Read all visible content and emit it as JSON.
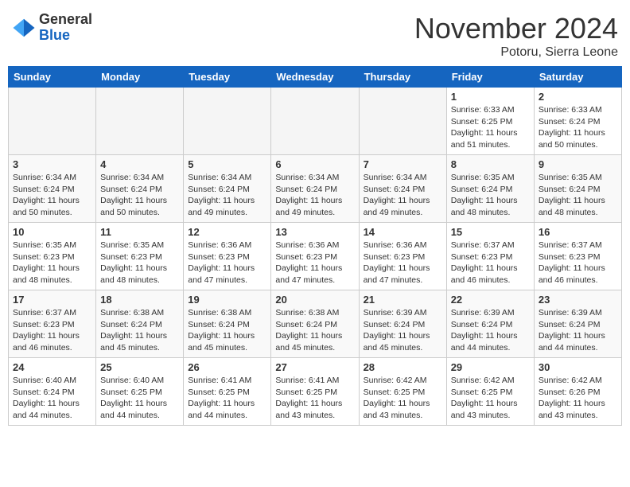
{
  "header": {
    "logo_general": "General",
    "logo_blue": "Blue",
    "month_title": "November 2024",
    "location": "Potoru, Sierra Leone"
  },
  "days_of_week": [
    "Sunday",
    "Monday",
    "Tuesday",
    "Wednesday",
    "Thursday",
    "Friday",
    "Saturday"
  ],
  "weeks": [
    [
      {
        "num": "",
        "info": ""
      },
      {
        "num": "",
        "info": ""
      },
      {
        "num": "",
        "info": ""
      },
      {
        "num": "",
        "info": ""
      },
      {
        "num": "",
        "info": ""
      },
      {
        "num": "1",
        "info": "Sunrise: 6:33 AM\nSunset: 6:25 PM\nDaylight: 11 hours and 51 minutes."
      },
      {
        "num": "2",
        "info": "Sunrise: 6:33 AM\nSunset: 6:24 PM\nDaylight: 11 hours and 50 minutes."
      }
    ],
    [
      {
        "num": "3",
        "info": "Sunrise: 6:34 AM\nSunset: 6:24 PM\nDaylight: 11 hours and 50 minutes."
      },
      {
        "num": "4",
        "info": "Sunrise: 6:34 AM\nSunset: 6:24 PM\nDaylight: 11 hours and 50 minutes."
      },
      {
        "num": "5",
        "info": "Sunrise: 6:34 AM\nSunset: 6:24 PM\nDaylight: 11 hours and 49 minutes."
      },
      {
        "num": "6",
        "info": "Sunrise: 6:34 AM\nSunset: 6:24 PM\nDaylight: 11 hours and 49 minutes."
      },
      {
        "num": "7",
        "info": "Sunrise: 6:34 AM\nSunset: 6:24 PM\nDaylight: 11 hours and 49 minutes."
      },
      {
        "num": "8",
        "info": "Sunrise: 6:35 AM\nSunset: 6:24 PM\nDaylight: 11 hours and 48 minutes."
      },
      {
        "num": "9",
        "info": "Sunrise: 6:35 AM\nSunset: 6:24 PM\nDaylight: 11 hours and 48 minutes."
      }
    ],
    [
      {
        "num": "10",
        "info": "Sunrise: 6:35 AM\nSunset: 6:23 PM\nDaylight: 11 hours and 48 minutes."
      },
      {
        "num": "11",
        "info": "Sunrise: 6:35 AM\nSunset: 6:23 PM\nDaylight: 11 hours and 48 minutes."
      },
      {
        "num": "12",
        "info": "Sunrise: 6:36 AM\nSunset: 6:23 PM\nDaylight: 11 hours and 47 minutes."
      },
      {
        "num": "13",
        "info": "Sunrise: 6:36 AM\nSunset: 6:23 PM\nDaylight: 11 hours and 47 minutes."
      },
      {
        "num": "14",
        "info": "Sunrise: 6:36 AM\nSunset: 6:23 PM\nDaylight: 11 hours and 47 minutes."
      },
      {
        "num": "15",
        "info": "Sunrise: 6:37 AM\nSunset: 6:23 PM\nDaylight: 11 hours and 46 minutes."
      },
      {
        "num": "16",
        "info": "Sunrise: 6:37 AM\nSunset: 6:23 PM\nDaylight: 11 hours and 46 minutes."
      }
    ],
    [
      {
        "num": "17",
        "info": "Sunrise: 6:37 AM\nSunset: 6:23 PM\nDaylight: 11 hours and 46 minutes."
      },
      {
        "num": "18",
        "info": "Sunrise: 6:38 AM\nSunset: 6:24 PM\nDaylight: 11 hours and 45 minutes."
      },
      {
        "num": "19",
        "info": "Sunrise: 6:38 AM\nSunset: 6:24 PM\nDaylight: 11 hours and 45 minutes."
      },
      {
        "num": "20",
        "info": "Sunrise: 6:38 AM\nSunset: 6:24 PM\nDaylight: 11 hours and 45 minutes."
      },
      {
        "num": "21",
        "info": "Sunrise: 6:39 AM\nSunset: 6:24 PM\nDaylight: 11 hours and 45 minutes."
      },
      {
        "num": "22",
        "info": "Sunrise: 6:39 AM\nSunset: 6:24 PM\nDaylight: 11 hours and 44 minutes."
      },
      {
        "num": "23",
        "info": "Sunrise: 6:39 AM\nSunset: 6:24 PM\nDaylight: 11 hours and 44 minutes."
      }
    ],
    [
      {
        "num": "24",
        "info": "Sunrise: 6:40 AM\nSunset: 6:24 PM\nDaylight: 11 hours and 44 minutes."
      },
      {
        "num": "25",
        "info": "Sunrise: 6:40 AM\nSunset: 6:25 PM\nDaylight: 11 hours and 44 minutes."
      },
      {
        "num": "26",
        "info": "Sunrise: 6:41 AM\nSunset: 6:25 PM\nDaylight: 11 hours and 44 minutes."
      },
      {
        "num": "27",
        "info": "Sunrise: 6:41 AM\nSunset: 6:25 PM\nDaylight: 11 hours and 43 minutes."
      },
      {
        "num": "28",
        "info": "Sunrise: 6:42 AM\nSunset: 6:25 PM\nDaylight: 11 hours and 43 minutes."
      },
      {
        "num": "29",
        "info": "Sunrise: 6:42 AM\nSunset: 6:25 PM\nDaylight: 11 hours and 43 minutes."
      },
      {
        "num": "30",
        "info": "Sunrise: 6:42 AM\nSunset: 6:26 PM\nDaylight: 11 hours and 43 minutes."
      }
    ]
  ]
}
